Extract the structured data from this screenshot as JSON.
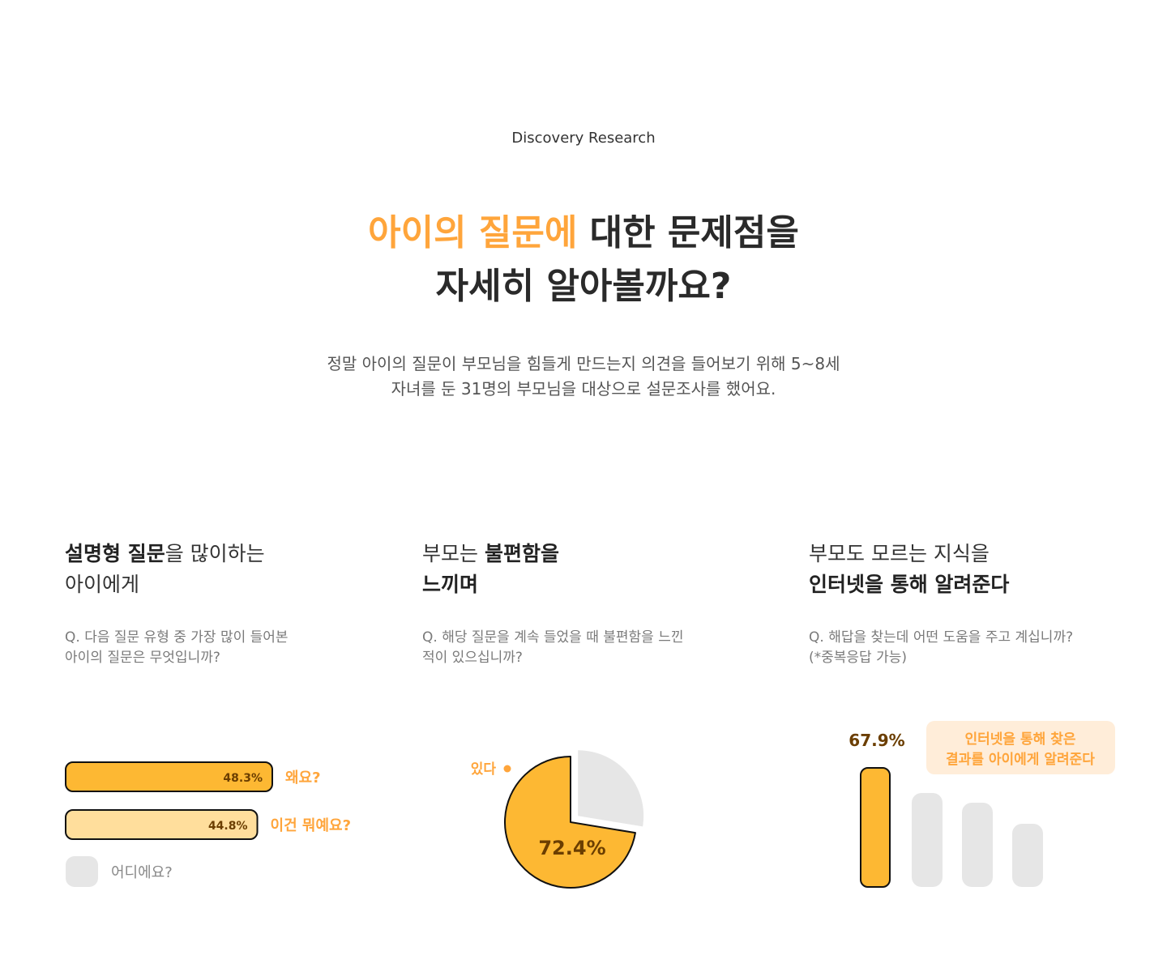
{
  "header": {
    "eyebrow": "Discovery Research",
    "headline_accent": "아이의 질문에",
    "headline_rest_line1": " 대한 문제점을",
    "headline_line2": "자세히 알아볼까요?",
    "lead_line1": "정말 아이의 질문이 부모님을 힘들게 만드는지 의견을 들어보기 위해 5~8세",
    "lead_line2": "자녀를 둔 31명의 부모님을 대상으로 설문조사를 했어요."
  },
  "colors": {
    "accent": "#FFA53B",
    "bar_primary": "#FDB833",
    "bar_secondary": "#FFDE9C",
    "bar_inactive": "#E6E6E6",
    "label_dark": "#6B3E00",
    "callout_bg": "#FFEDD9"
  },
  "findings": [
    {
      "title_bold_1": "설명형 질문",
      "title_rest_1": "을 많이하는",
      "title_line2": "아이에게",
      "question_line1": "Q. 다음 질문 유형 중 가장 많이 들어본",
      "question_line2": "아이의 질문은 무엇입니까?"
    },
    {
      "title_plain_1": "부모는 ",
      "title_bold_1": "불편함을",
      "title_line2": "느끼며",
      "question_line1": "Q. 해당 질문을 계속 들었을 때 불편함을 느낀",
      "question_line2": "적이 있으십니까?"
    },
    {
      "title_line1": "부모도 모르는 지식을",
      "title_line2": "인터넷을 통해 알려준다",
      "question_line1": "Q. 해답을 찾는데 어떤 도움을 주고 계십니까?",
      "question_line2": "(*중복응답 가능)"
    }
  ],
  "chart_data": [
    {
      "type": "bar",
      "orientation": "horizontal",
      "categories": [
        "왜요?",
        "이건 뭐예요?",
        "어디에요?"
      ],
      "values": [
        48.3,
        44.8,
        null
      ],
      "value_labels": [
        "48.3%",
        "44.8%",
        ""
      ],
      "ylim": [
        0,
        100
      ]
    },
    {
      "type": "pie",
      "slices": [
        {
          "label": "있다",
          "value": 72.4,
          "value_label": "72.4%"
        },
        {
          "label": "",
          "value": 27.6
        }
      ]
    },
    {
      "type": "bar",
      "orientation": "vertical",
      "categories": [
        "인터넷을 통해 찾은 결과를 아이에게 알려준다",
        "",
        "",
        ""
      ],
      "values": [
        67.9,
        null,
        null,
        null
      ],
      "value_labels": [
        "67.9%",
        "",
        "",
        ""
      ],
      "callout_line1": "인터넷을 통해 찾은",
      "callout_line2": "결과를 아이에게 알려준다"
    }
  ]
}
